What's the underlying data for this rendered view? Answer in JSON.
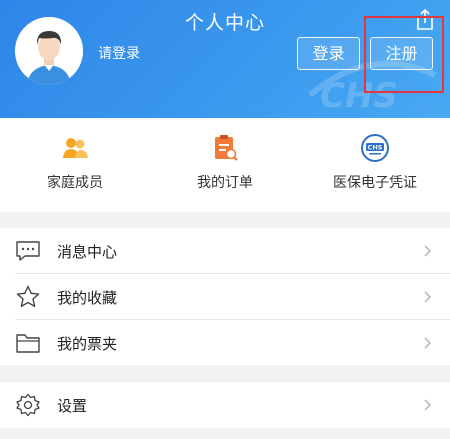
{
  "header": {
    "title": "个人中心",
    "login_hint": "请登录",
    "login_label": "登录",
    "register_label": "注册",
    "watermark_text": "CHS",
    "background_color": "#3a92ec"
  },
  "shortcuts": [
    {
      "label": "家庭成员",
      "icon": "family-members-icon",
      "color": "#f5a623"
    },
    {
      "label": "我的订单",
      "icon": "order-document-icon",
      "color": "#f07a3a"
    },
    {
      "label": "医保电子凭证",
      "icon": "chs-badge-icon",
      "color": "#2e6fc4",
      "badge_text": "CHS"
    }
  ],
  "menu_group_1": [
    {
      "label": "消息中心",
      "icon": "message-bubble-icon"
    },
    {
      "label": "我的收藏",
      "icon": "star-outline-icon"
    },
    {
      "label": "我的票夹",
      "icon": "folder-icon"
    }
  ],
  "menu_group_2": [
    {
      "label": "设置",
      "icon": "gear-icon"
    }
  ],
  "highlight_color": "#e4373d"
}
